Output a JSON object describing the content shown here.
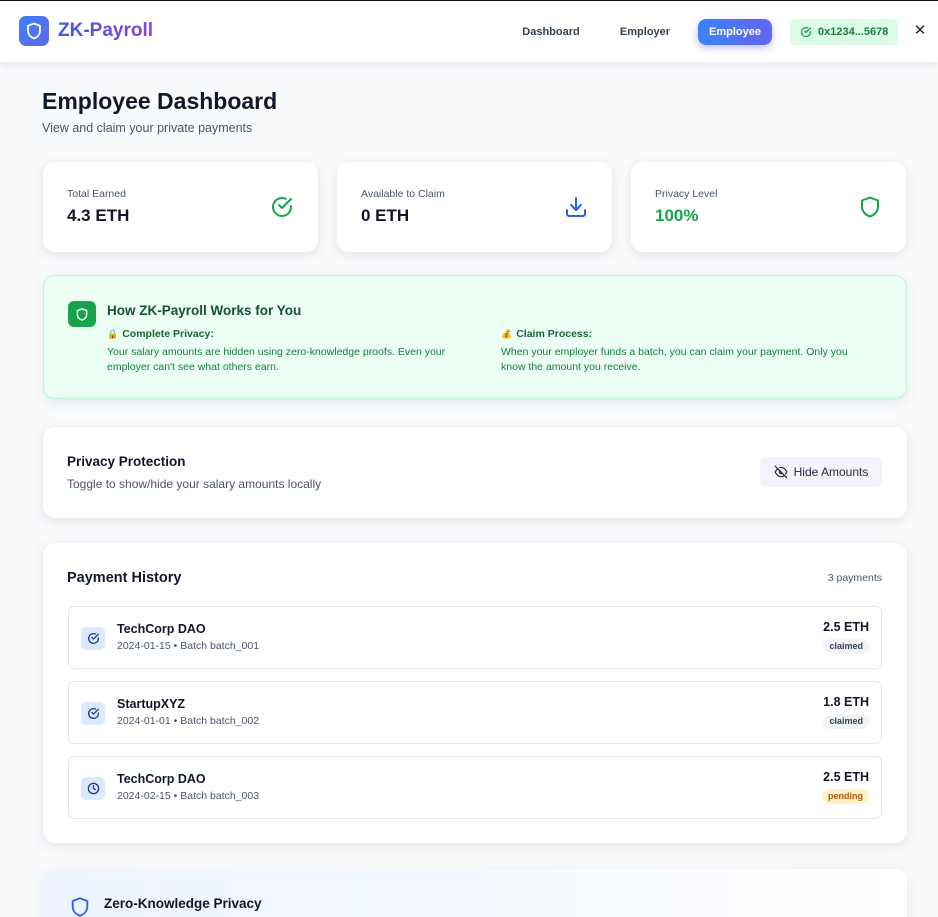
{
  "header": {
    "brand": "ZK-Payroll",
    "nav": [
      {
        "label": "Dashboard"
      },
      {
        "label": "Employer"
      },
      {
        "label": "Employee",
        "active": true
      }
    ],
    "wallet": "0x1234...5678",
    "close_icon": "close-icon"
  },
  "page": {
    "title": "Employee Dashboard",
    "subtitle": "View and claim your private payments"
  },
  "stats": [
    {
      "label": "Total Earned",
      "value": "4.3 ETH",
      "icon": "check-circle-icon"
    },
    {
      "label": "Available to Claim",
      "value": "0 ETH",
      "icon": "download-icon"
    },
    {
      "label": "Privacy Level",
      "value": "100%",
      "icon": "shield-icon"
    }
  ],
  "how_it_works": {
    "title": "How ZK-Payroll Works for You",
    "items": [
      {
        "emoji": "🔒",
        "heading": "Complete Privacy:",
        "text": "Your salary amounts are hidden using zero-knowledge proofs. Even your employer can't see what others earn."
      },
      {
        "emoji": "💰",
        "heading": "Claim Process:",
        "text": "When your employer funds a batch, you can claim your payment. Only you know the amount you receive."
      }
    ]
  },
  "privacy_protection": {
    "title": "Privacy Protection",
    "subtitle": "Toggle to show/hide your salary amounts locally",
    "button_label": "Hide Amounts"
  },
  "payment_history": {
    "title": "Payment History",
    "count": "3 payments",
    "rows": [
      {
        "name": "TechCorp DAO",
        "meta": "2024-01-15 • Batch batch_001",
        "amount": "2.5 ETH",
        "status": "claimed",
        "icon": "check-circle-icon"
      },
      {
        "name": "StartupXYZ",
        "meta": "2024-01-01 • Batch batch_002",
        "amount": "1.8 ETH",
        "status": "claimed",
        "icon": "check-circle-icon"
      },
      {
        "name": "TechCorp DAO",
        "meta": "2024-02-15 • Batch batch_003",
        "amount": "2.5 ETH",
        "status": "pending",
        "icon": "clock-icon"
      }
    ]
  },
  "zk_section": {
    "title": "Zero-Knowledge Privacy"
  },
  "colors": {
    "primary": "#4f63e6",
    "success": "#16a34a",
    "pending": "#b45309"
  }
}
